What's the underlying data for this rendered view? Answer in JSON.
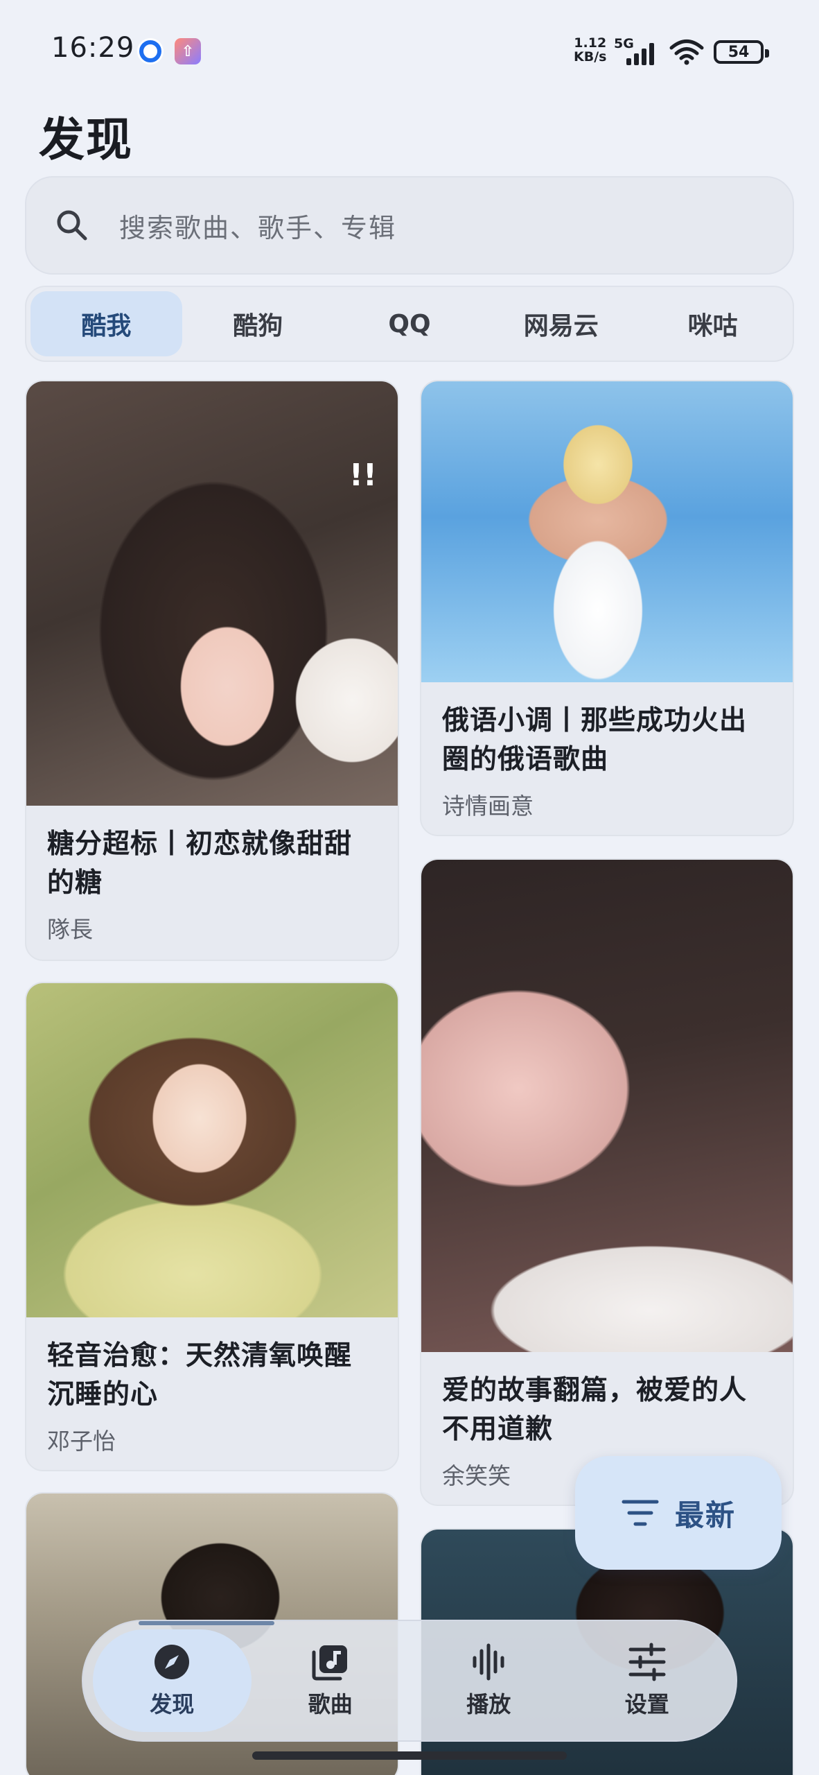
{
  "status_bar": {
    "time": "16:29",
    "net_speed_value": "1.12",
    "net_speed_unit": "KB/s",
    "network_type": "5G",
    "battery": "54"
  },
  "page": {
    "title": "发现"
  },
  "search": {
    "placeholder": "搜索歌曲、歌手、专辑"
  },
  "tabs": [
    {
      "label": "酷我",
      "active": true
    },
    {
      "label": "酷狗",
      "active": false
    },
    {
      "label": "QQ",
      "active": false
    },
    {
      "label": "网易云",
      "active": false
    },
    {
      "label": "咪咕",
      "active": false
    }
  ],
  "playlists": [
    {
      "title": "糖分超标丨初恋就像甜甜的糖",
      "author": "隊長"
    },
    {
      "title": "俄语小调丨那些成功火出圈的俄语歌曲",
      "author": "诗情画意"
    },
    {
      "title": "轻音治愈：天然清氧唤醒沉睡的心",
      "author": "邓子怡"
    },
    {
      "title": "爱的故事翻篇，被爱的人不用道歉",
      "author": "余笑笑"
    }
  ],
  "fab": {
    "label": "最新",
    "icon": "sort-filter-icon"
  },
  "bottom_nav": [
    {
      "label": "发现",
      "icon": "compass-icon",
      "active": true
    },
    {
      "label": "歌曲",
      "icon": "music-library-icon",
      "active": false
    },
    {
      "label": "播放",
      "icon": "waveform-icon",
      "active": false
    },
    {
      "label": "设置",
      "icon": "sliders-icon",
      "active": false
    }
  ],
  "colors": {
    "background": "#eef1f8",
    "accent": "#d3e2f6",
    "accent_text": "#2d5285"
  }
}
